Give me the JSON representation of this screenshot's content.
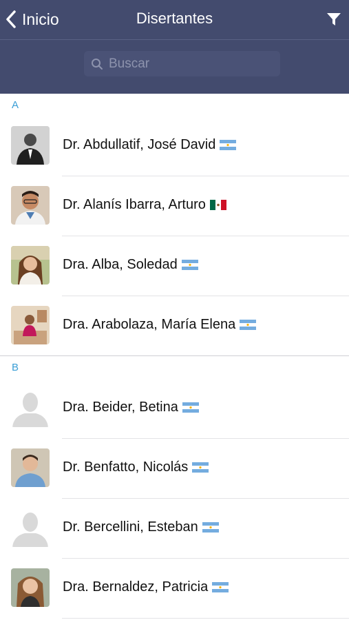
{
  "nav": {
    "back_label": "Inicio",
    "title": "Disertantes"
  },
  "search": {
    "placeholder": "Buscar",
    "value": ""
  },
  "sections": [
    {
      "letter": "A",
      "speakers": [
        {
          "name": "Dr. Abdullatif, José David",
          "flag": "argentina-flag-icon",
          "avatar": "photo"
        },
        {
          "name": "Dr. Alanís Ibarra, Arturo",
          "flag": "mexico-flag-icon",
          "avatar": "photo"
        },
        {
          "name": "Dra. Alba, Soledad",
          "flag": "argentina-flag-icon",
          "avatar": "photo"
        },
        {
          "name": "Dra. Arabolaza, María Elena",
          "flag": "argentina-flag-icon",
          "avatar": "photo"
        }
      ]
    },
    {
      "letter": "B",
      "speakers": [
        {
          "name": "Dra. Beider, Betina",
          "flag": "argentina-flag-icon",
          "avatar": "placeholder"
        },
        {
          "name": "Dr. Benfatto, Nicolás",
          "flag": "argentina-flag-icon",
          "avatar": "photo"
        },
        {
          "name": "Dr. Bercellini, Esteban",
          "flag": "argentina-flag-icon",
          "avatar": "placeholder"
        },
        {
          "name": "Dra. Bernaldez, Patricia",
          "flag": "argentina-flag-icon",
          "avatar": "photo"
        }
      ]
    }
  ],
  "colors": {
    "navbar": "#434b6e",
    "section_letter": "#3a9ed6"
  }
}
